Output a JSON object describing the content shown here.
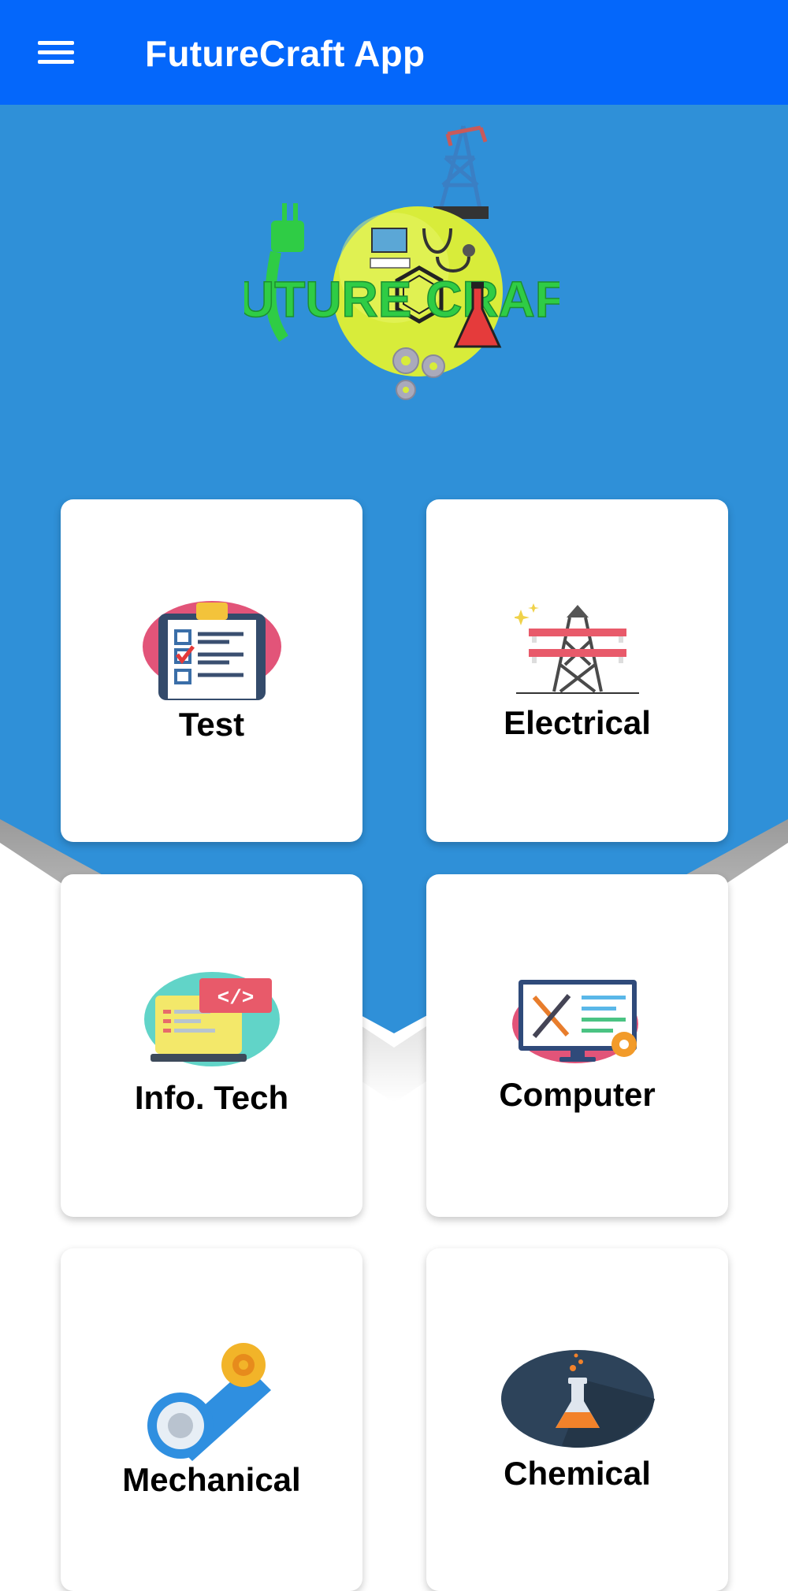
{
  "app_bar": {
    "title": "FutureCraft App",
    "menu_icon": "hamburger-menu-icon",
    "background_color": "#0467fb"
  },
  "hero": {
    "background_color": "#2f90d8",
    "logo_text": "FUTURE CRAFT"
  },
  "categories": [
    {
      "label": "Test",
      "icon": "test-checklist-icon"
    },
    {
      "label": "Electrical",
      "icon": "electrical-tower-icon"
    },
    {
      "label": "Info. Tech",
      "icon": "info-tech-code-icon"
    },
    {
      "label": "Computer",
      "icon": "computer-tools-icon"
    },
    {
      "label": "Mechanical",
      "icon": "mechanical-gears-icon"
    },
    {
      "label": "Chemical",
      "icon": "chemical-flask-icon"
    }
  ]
}
